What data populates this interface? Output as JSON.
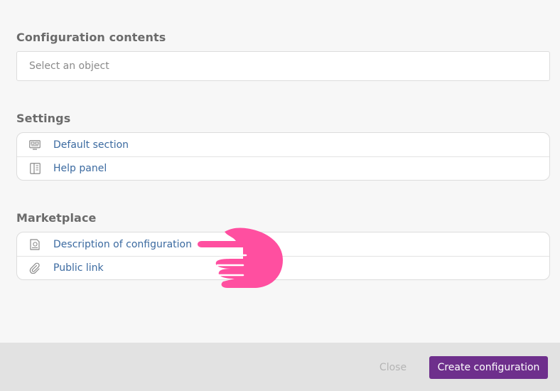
{
  "configuration_contents": {
    "title": "Configuration contents",
    "select_placeholder": "Select an object"
  },
  "settings": {
    "title": "Settings",
    "items": [
      {
        "label": "Default section",
        "icon": "default-section-icon"
      },
      {
        "label": "Help panel",
        "icon": "help-panel-icon"
      }
    ]
  },
  "marketplace": {
    "title": "Marketplace",
    "items": [
      {
        "label": "Description of configuration",
        "icon": "description-icon"
      },
      {
        "label": "Public link",
        "icon": "paperclip-icon"
      }
    ]
  },
  "footer": {
    "close_label": "Close",
    "create_label": "Create configuration"
  },
  "colors": {
    "accent": "#6e2f8c",
    "link": "#3b6aa0",
    "pointer": "#ff4fa0"
  }
}
